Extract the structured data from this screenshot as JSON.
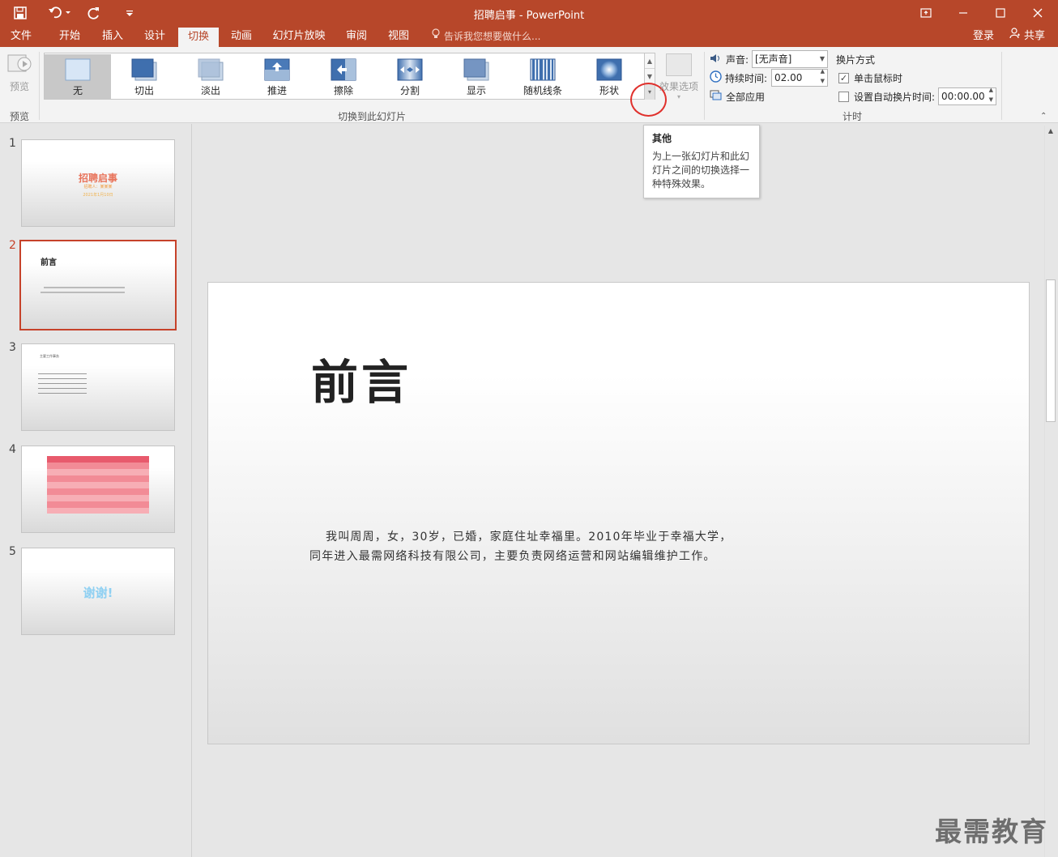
{
  "app": {
    "title": "招聘启事 - PowerPoint"
  },
  "qat": {
    "save": "save-icon",
    "undo": "undo-icon",
    "redo": "redo-icon",
    "customize": "customize-icon"
  },
  "tabs": [
    {
      "label": "文件"
    },
    {
      "label": "开始"
    },
    {
      "label": "插入"
    },
    {
      "label": "设计"
    },
    {
      "label": "切换",
      "active": true
    },
    {
      "label": "动画"
    },
    {
      "label": "幻灯片放映"
    },
    {
      "label": "审阅"
    },
    {
      "label": "视图"
    }
  ],
  "tellme": "告诉我您想要做什么...",
  "account": {
    "signin": "登录",
    "share": "共享"
  },
  "ribbon": {
    "preview": {
      "label": "预览",
      "group": "预览"
    },
    "gallery": {
      "group": "切换到此幻灯片",
      "items": [
        {
          "label": "无",
          "selected": true
        },
        {
          "label": "切出"
        },
        {
          "label": "淡出"
        },
        {
          "label": "推进"
        },
        {
          "label": "擦除"
        },
        {
          "label": "分割"
        },
        {
          "label": "显示"
        },
        {
          "label": "随机线条"
        },
        {
          "label": "形状"
        }
      ]
    },
    "effect_options": "效果选项",
    "sound": {
      "label": "声音:",
      "value": "[无声音]"
    },
    "duration": {
      "label": "持续时间:",
      "value": "02.00"
    },
    "apply_all": "全部应用",
    "advance": {
      "title": "换片方式",
      "on_click": "单击鼠标时",
      "on_click_checked": true,
      "after": "设置自动换片时间:",
      "after_checked": false,
      "after_value": "00:00.00"
    },
    "timing_group": "计时"
  },
  "tooltip": {
    "title": "其他",
    "desc": "为上一张幻灯片和此幻灯片之间的切换选择一种特殊效果。"
  },
  "slides": [
    {
      "num": "1",
      "title": "招聘启事",
      "sub1": "招聘人：某某某",
      "sub2": "2021年1月10日"
    },
    {
      "num": "2",
      "title": "前言",
      "selected": true
    },
    {
      "num": "3",
      "title": "主要工作事务"
    },
    {
      "num": "4",
      "title": "表格"
    },
    {
      "num": "5",
      "title": "谢谢!"
    }
  ],
  "current_slide": {
    "title": "前言",
    "body_line1": "我叫周周，女，30岁，已婚，家庭住址幸福里。2010年毕业于幸福大学，",
    "body_line2": "同年进入最需网络科技有限公司，主要负责网络运营和网站编辑维护工作。"
  },
  "watermark": "最需教育"
}
